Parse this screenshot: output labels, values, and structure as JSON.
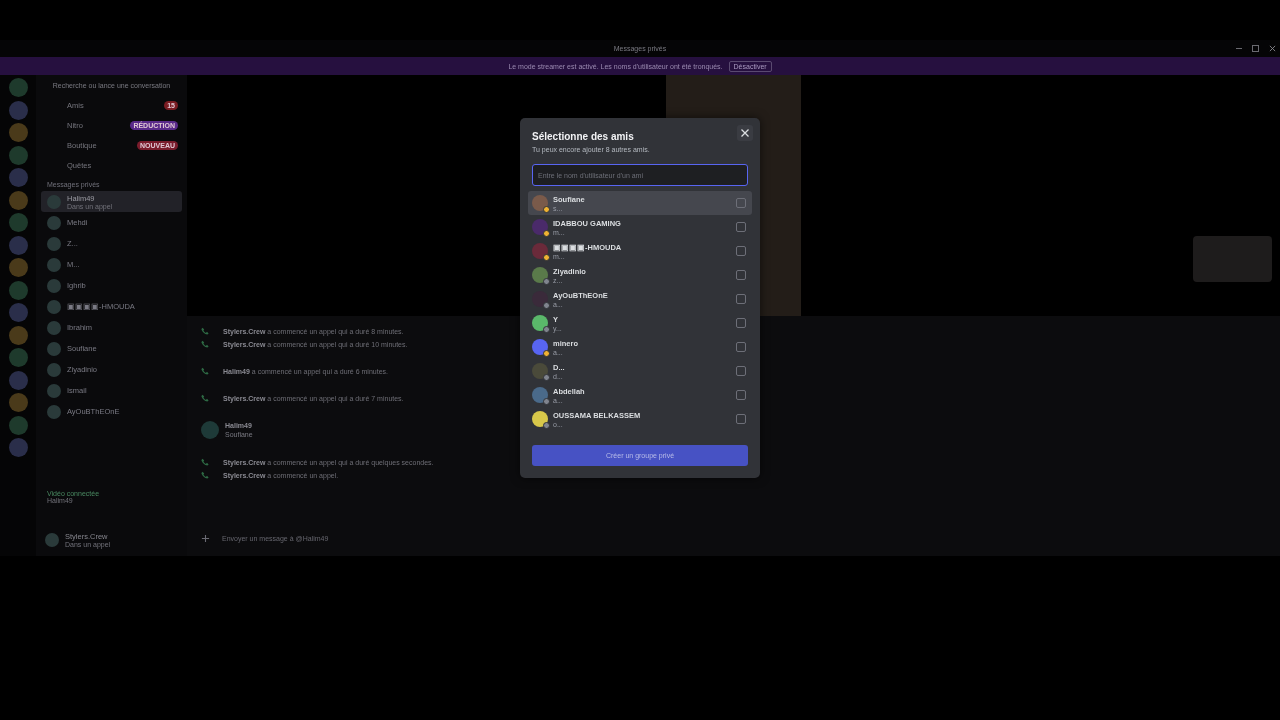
{
  "window": {
    "title": "Messages privés"
  },
  "banner": {
    "text": "Le mode streamer est activé. Les noms d'utilisateur ont été tronqués.",
    "button": "Désactiver"
  },
  "sidebar": {
    "search": "Recherche ou lance une conversation",
    "nav": [
      {
        "label": "Amis",
        "badge": "15",
        "kind": "count"
      },
      {
        "label": "Nitro",
        "badge": "RÉDUCTION",
        "kind": "promo"
      },
      {
        "label": "Boutique",
        "badge": "NOUVEAU",
        "kind": "new"
      },
      {
        "label": "Quêtes"
      }
    ],
    "dm_header": "Messages privés",
    "dms": [
      {
        "name": "Halim49",
        "sub": "Dans un appel",
        "selected": true
      },
      {
        "name": "Mehdi",
        "selected": false
      },
      {
        "name": "Z...",
        "selected": false
      },
      {
        "name": "M...",
        "selected": false
      },
      {
        "name": "Ighrib",
        "selected": false
      },
      {
        "name": "▣▣▣▣-HMOUDA",
        "selected": false
      },
      {
        "name": "Ibrahim",
        "selected": false
      },
      {
        "name": "Soufiane",
        "selected": false
      },
      {
        "name": "Ziyadinio",
        "selected": false
      },
      {
        "name": "Ismail",
        "selected": false
      },
      {
        "name": "AyOuBThEOnE",
        "selected": false
      }
    ],
    "voice": {
      "status": "Vidéo connectée",
      "channel": "Halim49"
    },
    "user": {
      "name": "Stylers.Crew",
      "status": "Dans un appel"
    }
  },
  "chat": {
    "messages": [
      {
        "kind": "call",
        "author": "Stylers.Crew",
        "text": "a commencé un appel qui a duré 8 minutes."
      },
      {
        "kind": "call",
        "author": "Stylers.Crew",
        "text": "a commencé un appel qui a duré 10 minutes."
      },
      {
        "kind": "call",
        "author": "Halim49",
        "text": "a commencé un appel qui a duré 6 minutes."
      },
      {
        "kind": "call",
        "author": "Stylers.Crew",
        "text": "a commencé un appel qui a duré 7 minutes."
      },
      {
        "kind": "message",
        "author": "Halim49",
        "text": "Soufiane"
      },
      {
        "kind": "call",
        "author": "Stylers.Crew",
        "text": "a commencé un appel qui a duré quelques secondes."
      },
      {
        "kind": "call",
        "author": "Stylers.Crew",
        "text": "a commencé un appel."
      }
    ],
    "input_placeholder": "Envoyer un message à @Halim49"
  },
  "modal": {
    "title": "Sélectionne des amis",
    "subtitle": "Tu peux encore ajouter 8 autres amis.",
    "search_placeholder": "Entre le nom d'utilisateur d'un ami",
    "friends": [
      {
        "name": "Soufiane",
        "sub": "s...",
        "kind": "idle",
        "hovered": true,
        "checked": false
      },
      {
        "name": "IDABBOU GAMING",
        "sub": "m...",
        "kind": "idle",
        "hovered": false,
        "checked": false
      },
      {
        "name": "▣▣▣▣-HMOUDA",
        "sub": "m...",
        "kind": "idle",
        "hovered": false,
        "checked": false
      },
      {
        "name": "Ziyadinio",
        "sub": "z...",
        "kind": "offline",
        "hovered": false,
        "checked": false
      },
      {
        "name": "AyOuBThEOnE",
        "sub": "a...",
        "kind": "offline",
        "hovered": false,
        "checked": false
      },
      {
        "name": "Y",
        "sub": "y...",
        "kind": "offline",
        "hovered": false,
        "checked": false
      },
      {
        "name": "minero",
        "sub": "a...",
        "kind": "idle",
        "hovered": false,
        "checked": false
      },
      {
        "name": "D...",
        "sub": "d...",
        "kind": "offline",
        "hovered": false,
        "checked": false
      },
      {
        "name": "Abdellah",
        "sub": "a...",
        "kind": "offline",
        "hovered": false,
        "checked": false
      },
      {
        "name": "OUSSAMA BELKASSEM",
        "sub": "o...",
        "kind": "offline",
        "hovered": false,
        "checked": false
      }
    ],
    "button": "Créer un groupe privé"
  }
}
